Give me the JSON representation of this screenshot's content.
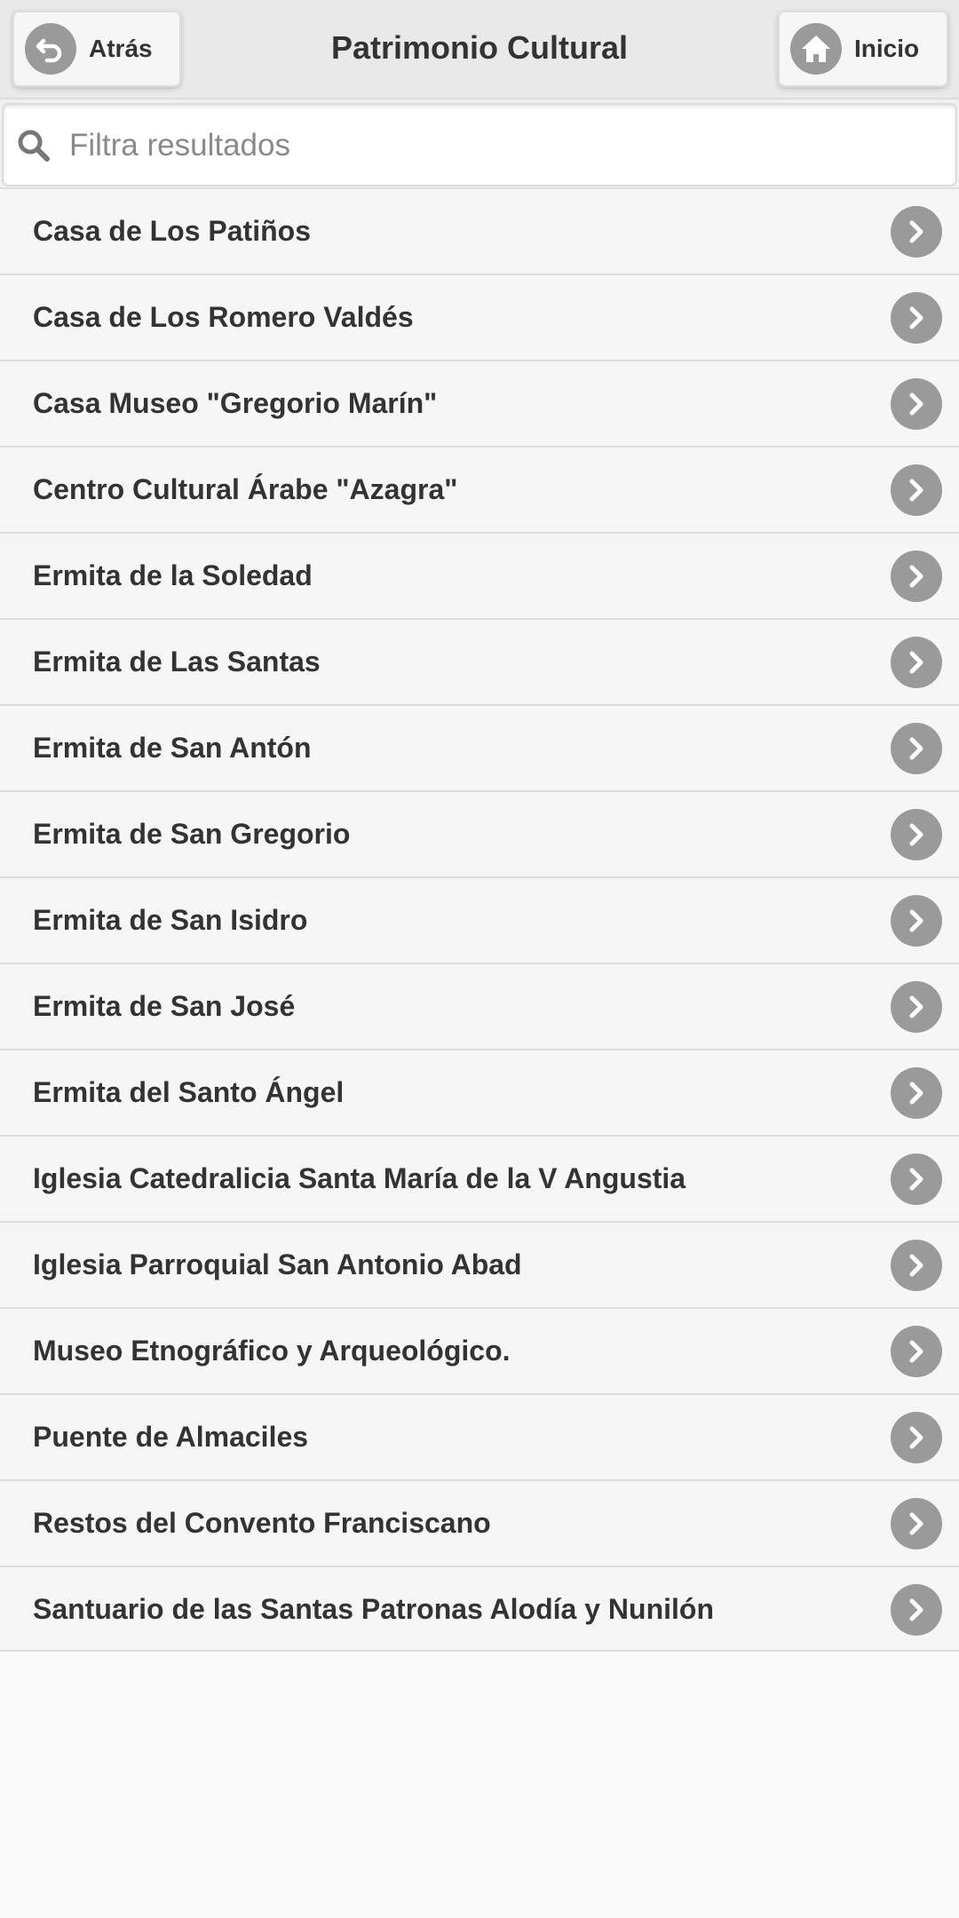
{
  "header": {
    "title": "Patrimonio Cultural",
    "back_label": "Atrás",
    "home_label": "Inicio",
    "back_icon": "undo-arrow-icon",
    "home_icon": "home-icon"
  },
  "search": {
    "placeholder": "Filtra resultados",
    "value": "",
    "icon": "search-icon"
  },
  "list": {
    "chevron_icon": "chevron-right-icon",
    "items": [
      {
        "label": "Casa de Los Patiños"
      },
      {
        "label": "Casa de Los Romero Valdés"
      },
      {
        "label": "Casa Museo \"Gregorio Marín\""
      },
      {
        "label": "Centro Cultural Árabe \"Azagra\""
      },
      {
        "label": "Ermita de la Soledad"
      },
      {
        "label": "Ermita de Las Santas"
      },
      {
        "label": "Ermita de San Antón"
      },
      {
        "label": "Ermita de San Gregorio"
      },
      {
        "label": "Ermita de San Isidro"
      },
      {
        "label": "Ermita de San José"
      },
      {
        "label": "Ermita del Santo Ángel"
      },
      {
        "label": "Iglesia Catedralicia Santa María de la V Angustia"
      },
      {
        "label": "Iglesia Parroquial San Antonio Abad"
      },
      {
        "label": "Museo Etnográfico y Arqueológico."
      },
      {
        "label": "Puente de Almaciles"
      },
      {
        "label": "Restos del Convento Franciscano"
      },
      {
        "label": "Santuario de las Santas Patronas Alodía y Nunilón"
      }
    ]
  },
  "colors": {
    "header_bg": "#e9e9e9",
    "list_bg": "#f6f6f6",
    "icon_circle": "#9a9a9a",
    "text": "#333333"
  }
}
